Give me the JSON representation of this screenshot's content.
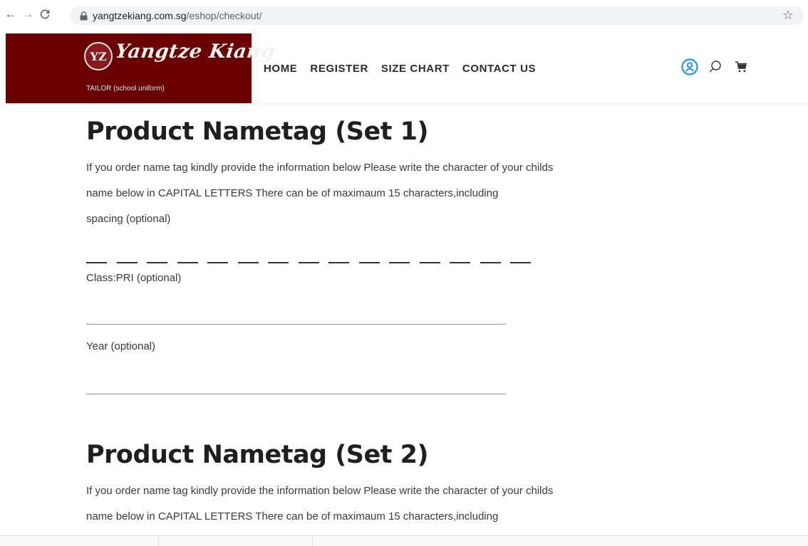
{
  "browser": {
    "url_domain": "yangtzekiang.com.sg",
    "url_path": "/eshop/checkout/",
    "back": "←",
    "forward": "→",
    "reload": "C",
    "bookmark": "☆"
  },
  "header": {
    "logo_emblem": "YZ",
    "logo_text": "Yangtze Kiang",
    "logo_tagline": "TAILOR (school uniform)",
    "nav": [
      "HOME",
      "REGISTER",
      "SIZE CHART",
      "CONTACT US"
    ],
    "icons": [
      "account-icon",
      "search-icon",
      "cart-icon"
    ],
    "colors": {
      "logo_bg": "#6b0000",
      "account_accent": "#2b9be3"
    }
  },
  "sections": [
    {
      "title": "Product Nametag (Set 1)",
      "desc_lines": [
        "If you order name tag kindly provide the information below Please write the character of your childs",
        "name below in CAPITAL LETTERS There can be of maximaum 15 characters,including",
        "spacing (optional)"
      ],
      "char_slots": 15,
      "fields": [
        {
          "label": "Class:PRI (optional)",
          "value": ""
        },
        {
          "label": "Year (optional)",
          "value": ""
        }
      ]
    },
    {
      "title": "Product Nametag (Set 2)",
      "desc_lines": [
        "If you order name tag kindly provide the information below Please write the character of your childs",
        "name below in CAPITAL LETTERS There can be of maximaum 15 characters,including"
      ]
    }
  ]
}
